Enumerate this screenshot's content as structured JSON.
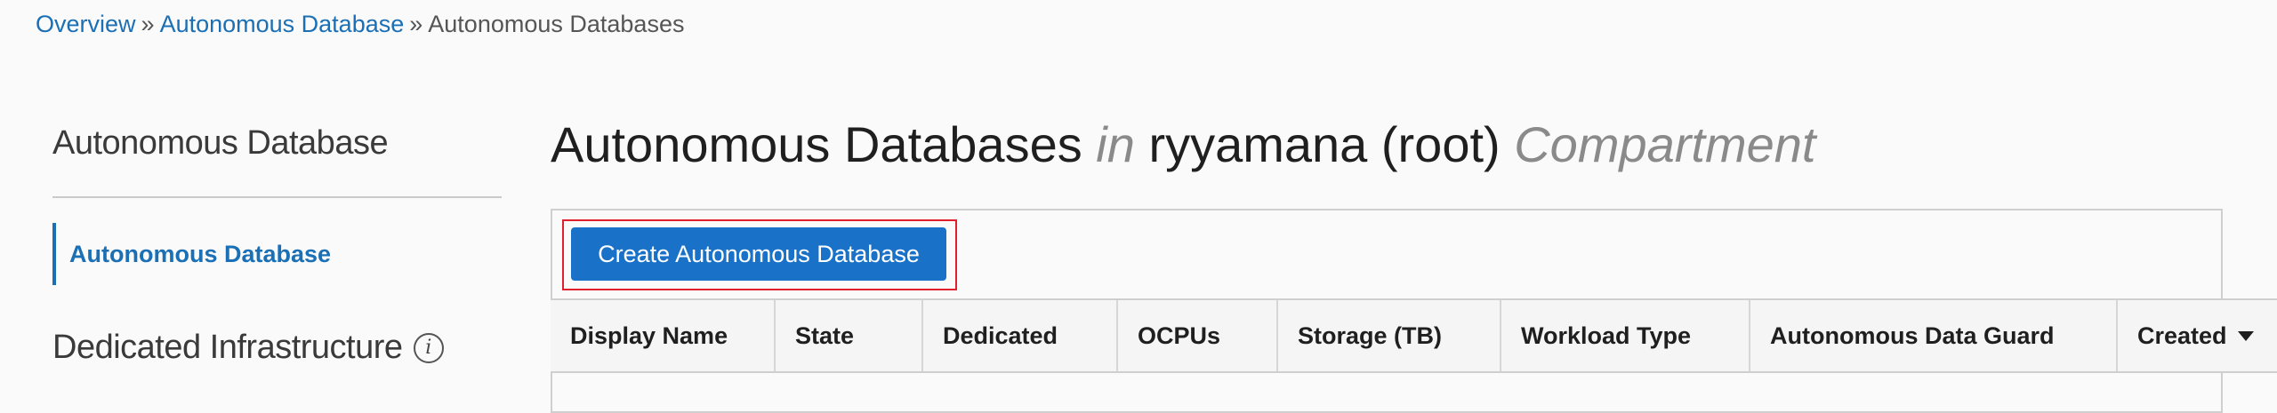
{
  "breadcrumb": {
    "items": [
      "Overview",
      "Autonomous Database"
    ],
    "separator": "»",
    "current": "Autonomous Databases"
  },
  "sidebar": {
    "title": "Autonomous Database",
    "items": [
      {
        "label": "Autonomous Database",
        "active": true
      },
      {
        "label": "Dedicated Infrastructure",
        "icon": "info-icon"
      }
    ]
  },
  "header": {
    "title_main": "Autonomous Databases",
    "title_in": "in",
    "compartment_name": "ryyamana (root)",
    "title_suffix": "Compartment"
  },
  "toolbar": {
    "create_label": "Create Autonomous Database"
  },
  "table": {
    "columns": [
      "Display Name",
      "State",
      "Dedicated",
      "OCPUs",
      "Storage (TB)",
      "Workload Type",
      "Autonomous Data Guard",
      "Created"
    ],
    "sort_icon": "sort-descending-icon"
  },
  "colors": {
    "link": "#1a6fb5",
    "primary_button": "#1a72c8",
    "highlight": "#e0202e",
    "muted_text": "#8a8a8a"
  }
}
